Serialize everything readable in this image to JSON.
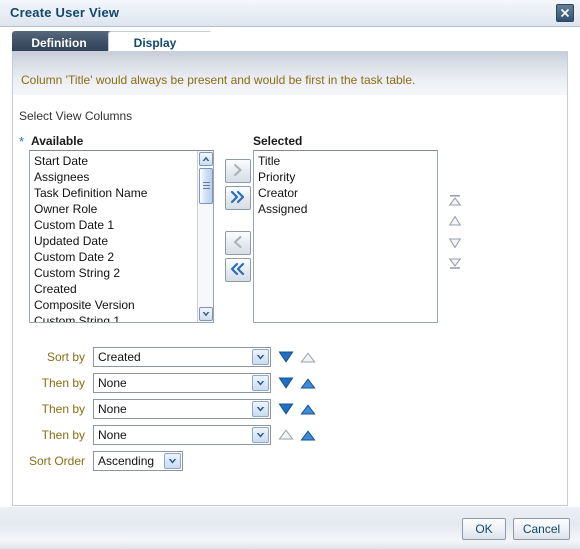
{
  "window": {
    "title": "Create User View",
    "close_icon": "close-icon"
  },
  "tabs": [
    {
      "label": "Definition",
      "active": false
    },
    {
      "label": "Display",
      "active": true
    }
  ],
  "message": {
    "text": "Column 'Title' would always be present and would be first in the task table.",
    "color": "#8a6d14"
  },
  "section": {
    "label": "Select View Columns",
    "required_marker": "*"
  },
  "shuttle": {
    "available": {
      "title": "Available",
      "items": [
        "Start Date",
        "Assignees",
        "Task Definition Name",
        "Owner Role",
        "Custom Date 1",
        "Updated Date",
        "Custom Date 2",
        "Custom String 2",
        "Created",
        "Composite Version",
        "Custom String 1"
      ]
    },
    "selected": {
      "title": "Selected",
      "items": [
        "Title",
        "Priority",
        "Creator",
        "Assigned"
      ]
    },
    "buttons": [
      {
        "name": "move-right-button",
        "icon": "chevron-right-icon",
        "enabled": false
      },
      {
        "name": "move-all-right-button",
        "icon": "double-chevron-right-icon",
        "enabled": true
      },
      {
        "name": "move-left-button",
        "icon": "chevron-left-icon",
        "enabled": false
      },
      {
        "name": "move-all-left-button",
        "icon": "double-chevron-left-icon",
        "enabled": true
      }
    ],
    "reorder_buttons": [
      {
        "name": "move-to-top-button",
        "icon": "move-to-top-icon",
        "enabled": false
      },
      {
        "name": "move-up-button",
        "icon": "move-up-icon",
        "enabled": false
      },
      {
        "name": "move-down-button",
        "icon": "move-down-icon",
        "enabled": false
      },
      {
        "name": "move-to-bottom-button",
        "icon": "move-to-bottom-icon",
        "enabled": false
      }
    ]
  },
  "sort": {
    "rows": [
      {
        "label": "Sort by",
        "value": "Created",
        "down_enabled": true,
        "up_enabled": false
      },
      {
        "label": "Then by",
        "value": "None",
        "down_enabled": true,
        "up_enabled": true
      },
      {
        "label": "Then by",
        "value": "None",
        "down_enabled": true,
        "up_enabled": true
      },
      {
        "label": "Then by",
        "value": "None",
        "down_enabled": false,
        "up_enabled": true
      }
    ],
    "order_row": {
      "label": "Sort Order",
      "value": "Ascending"
    }
  },
  "footer": {
    "ok_label": "OK",
    "cancel_label": "Cancel"
  },
  "colors": {
    "title_text": "#11486b",
    "message_text": "#8a6d14",
    "label_text": "#8a6d14",
    "accent_blue": "#2a6fb5"
  }
}
